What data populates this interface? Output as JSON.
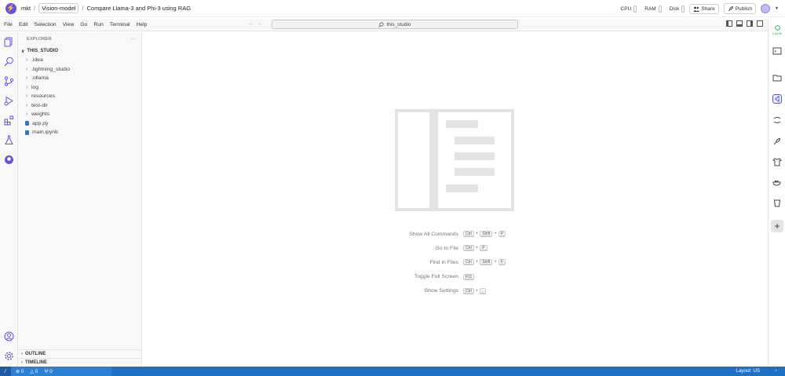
{
  "header": {
    "logo_glyph": "⚡",
    "org": "mkt",
    "project": "Vision-model",
    "studio_title": "Compare Llama-3 and Phi-3 using RAG",
    "cpu_label": "CPU",
    "ram_label": "RAM",
    "disk_label": "Disk",
    "share_label": "Share",
    "publish_label": "Publish"
  },
  "menu": [
    "File",
    "Edit",
    "Selection",
    "View",
    "Go",
    "Run",
    "Terminal",
    "Help"
  ],
  "command_center": {
    "text": "this_studio"
  },
  "explorer": {
    "title": "EXPLORER",
    "more": "···",
    "root": "THIS_STUDIO",
    "folders": [
      ".idea",
      ".lightning_studio",
      ".ollama",
      "log",
      "resources",
      "test-dir",
      "weights"
    ],
    "files": [
      {
        "name": "app.py",
        "icon": "python-icon",
        "color": "#3b76b0"
      },
      {
        "name": "main.ipynb",
        "icon": "notebook-icon",
        "color": "#3b76b0"
      }
    ],
    "outline": "OUTLINE",
    "timeline": "TIMELINE"
  },
  "shortcuts": [
    {
      "label": "Show All Commands",
      "keys": [
        "Ctrl",
        "Shift",
        "P"
      ]
    },
    {
      "label": "Go to File",
      "keys": [
        "Ctrl",
        "P"
      ]
    },
    {
      "label": "Find in Files",
      "keys": [
        "Ctrl",
        "Shift",
        "F"
      ]
    },
    {
      "label": "Toggle Full Screen",
      "keys": [
        "F11"
      ]
    },
    {
      "label": "Show Settings",
      "keys": [
        "Ctrl",
        ","
      ]
    }
  ],
  "right_rail": {
    "gpu_label": "1 A100"
  },
  "statusbar": {
    "errors": "0",
    "warnings": "0",
    "ports": "0",
    "layout": "Layout: US"
  },
  "colors": {
    "accent": "#6d4fe0",
    "status": "#1f6fc5"
  }
}
